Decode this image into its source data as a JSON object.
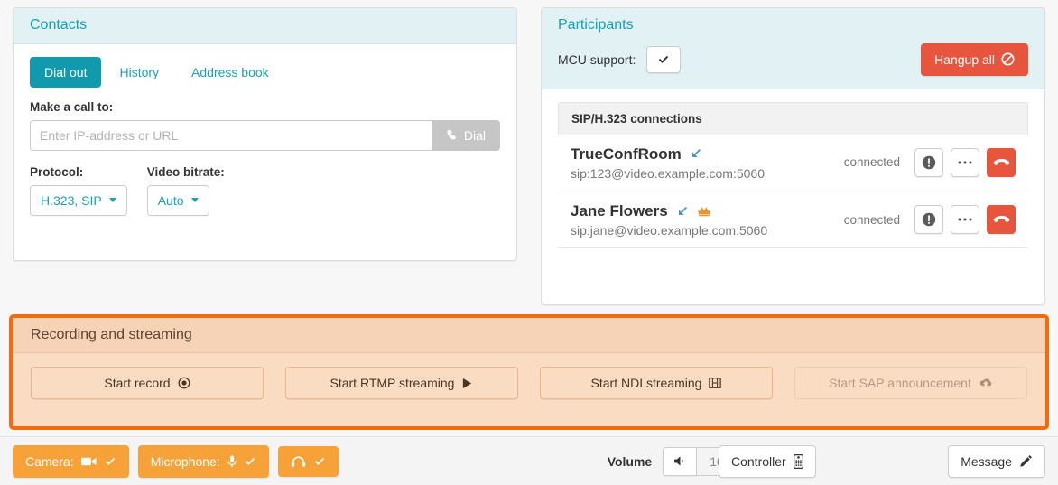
{
  "contacts": {
    "title": "Contacts",
    "tabs": [
      {
        "label": "Dial out",
        "active": true
      },
      {
        "label": "History",
        "active": false
      },
      {
        "label": "Address book",
        "active": false
      }
    ],
    "call_label": "Make a call to:",
    "call_input": {
      "value": "",
      "placeholder": "Enter IP-address or URL"
    },
    "dial_button": {
      "label": "Dial",
      "icon": "phone-icon",
      "disabled": true
    },
    "protocol": {
      "label": "Protocol:",
      "value": "H.323, SIP"
    },
    "bitrate": {
      "label": "Video bitrate:",
      "value": "Auto"
    }
  },
  "participants": {
    "title": "Participants",
    "mcu_label": "MCU support:",
    "mcu_checked": true,
    "mcu_icon": "check-icon",
    "hangup_all": {
      "label": "Hangup all",
      "icon": "no-entry-icon"
    },
    "connections_header": "SIP/H.323 connections",
    "rows": [
      {
        "name": "TrueConfRoom",
        "uri": "sip:123@video.example.com:5060",
        "status": "connected",
        "incoming": true,
        "moderator": false,
        "actions": [
          "info-icon",
          "ellipsis-icon",
          "hangup-icon"
        ]
      },
      {
        "name": "Jane Flowers",
        "uri": "sip:jane@video.example.com:5060",
        "status": "connected",
        "incoming": true,
        "moderator": true,
        "actions": [
          "info-icon",
          "ellipsis-icon",
          "hangup-icon"
        ]
      }
    ]
  },
  "recording": {
    "title": "Recording and streaming",
    "buttons": [
      {
        "label": "Start record",
        "icon": "record-icon",
        "disabled": false
      },
      {
        "label": "Start RTMP streaming",
        "icon": "play-icon",
        "disabled": false
      },
      {
        "label": "Start NDI streaming",
        "icon": "film-icon",
        "disabled": false
      },
      {
        "label": "Start SAP announcement",
        "icon": "cloud-upload-icon",
        "disabled": true
      }
    ]
  },
  "toolbar": {
    "camera": {
      "label": "Camera:",
      "icon": "video-camera-icon",
      "state_icon": "check-icon"
    },
    "microphone": {
      "label": "Microphone:",
      "icon": "microphone-icon",
      "state_icon": "check-icon"
    },
    "headphones": {
      "label": "",
      "icon": "headphones-icon",
      "state_icon": "check-icon"
    },
    "volume_label": "Volume",
    "volume_down_icon": "volume-low-icon",
    "volume_value": "100%",
    "volume_up_icon": "volume-high-icon",
    "controller": {
      "label": "Controller",
      "icon": "remote-control-icon"
    },
    "message": {
      "label": "Message",
      "icon": "pencil-icon"
    }
  },
  "colors": {
    "teal": "#13a3b5",
    "panel_header": "#e2f1f4",
    "red": "#e8553f",
    "orange_border": "#f26c0d",
    "peach": "#fadcc3",
    "toolbar_orange": "#f7a239",
    "arrow_blue": "#4a90d9",
    "crown_gold": "#f0922b"
  }
}
